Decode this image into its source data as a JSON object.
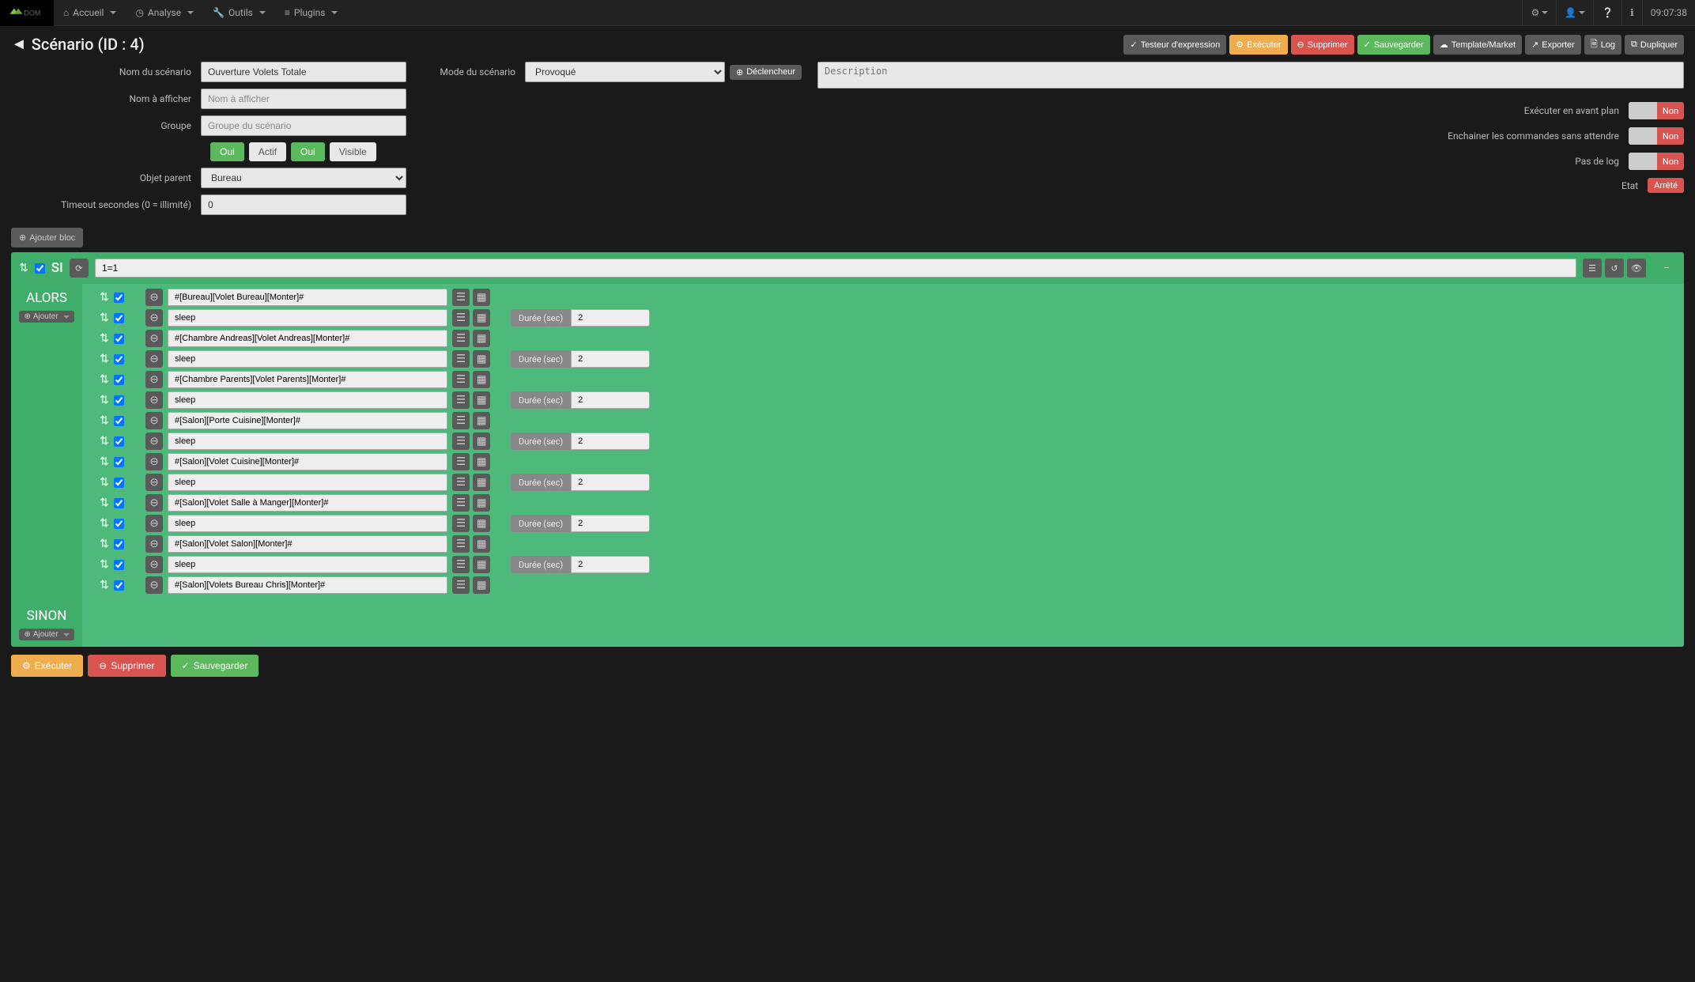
{
  "nav": {
    "accueil": "Accueil",
    "analyse": "Analyse",
    "outils": "Outils",
    "plugins": "Plugins",
    "clock": "09:07:38"
  },
  "title": "Scénario (ID : 4)",
  "topbtns": {
    "test": "Testeur d'expression",
    "exec": "Exécuter",
    "del": "Supprimer",
    "save": "Sauvegarder",
    "tpl": "Template/Market",
    "export": "Exporter",
    "log": "Log",
    "dup": "Dupliquer"
  },
  "form": {
    "name_label": "Nom du scénario",
    "name_value": "Ouverture Volets Totale",
    "display_label": "Nom à afficher",
    "display_ph": "Nom à afficher",
    "group_label": "Groupe",
    "group_ph": "Groupe du scénario",
    "oui": "Oui",
    "actif": "Actif",
    "visible": "Visible",
    "parent_label": "Objet parent",
    "parent_value": "Bureau",
    "timeout_label": "Timeout secondes (0 = illimité)",
    "timeout_value": "0",
    "mode_label": "Mode du scénario",
    "mode_value": "Provoqué",
    "trigger": "Déclencheur",
    "desc_ph": "Description",
    "foreground": "Exécuter en avant plan",
    "chain": "Enchainer les commandes sans attendre",
    "nolog": "Pas de log",
    "state": "Etat",
    "state_value": "Arrêté",
    "non": "Non"
  },
  "addblock": "Ajouter bloc",
  "block": {
    "si": "SI",
    "condition": "1=1",
    "alors": "ALORS",
    "sinon": "SINON",
    "ajouter": "Ajouter",
    "duree": "Durée (sec)"
  },
  "actions": [
    {
      "cmd": "#[Bureau][Volet Bureau][Monter]#",
      "sleep": false
    },
    {
      "cmd": "sleep",
      "sleep": true,
      "val": "2"
    },
    {
      "cmd": "#[Chambre Andreas][Volet Andreas][Monter]#",
      "sleep": false
    },
    {
      "cmd": "sleep",
      "sleep": true,
      "val": "2"
    },
    {
      "cmd": "#[Chambre Parents][Volet Parents][Monter]#",
      "sleep": false
    },
    {
      "cmd": "sleep",
      "sleep": true,
      "val": "2"
    },
    {
      "cmd": "#[Salon][Porte Cuisine][Monter]#",
      "sleep": false
    },
    {
      "cmd": "sleep",
      "sleep": true,
      "val": "2"
    },
    {
      "cmd": "#[Salon][Volet Cuisine][Monter]#",
      "sleep": false
    },
    {
      "cmd": "sleep",
      "sleep": true,
      "val": "2"
    },
    {
      "cmd": "#[Salon][Volet Salle à Manger][Monter]#",
      "sleep": false
    },
    {
      "cmd": "sleep",
      "sleep": true,
      "val": "2"
    },
    {
      "cmd": "#[Salon][Volet Salon][Monter]#",
      "sleep": false
    },
    {
      "cmd": "sleep",
      "sleep": true,
      "val": "2"
    },
    {
      "cmd": "#[Salon][Volets Bureau Chris][Monter]#",
      "sleep": false
    }
  ],
  "footer": {
    "exec": "Exécuter",
    "del": "Supprimer",
    "save": "Sauvegarder"
  }
}
